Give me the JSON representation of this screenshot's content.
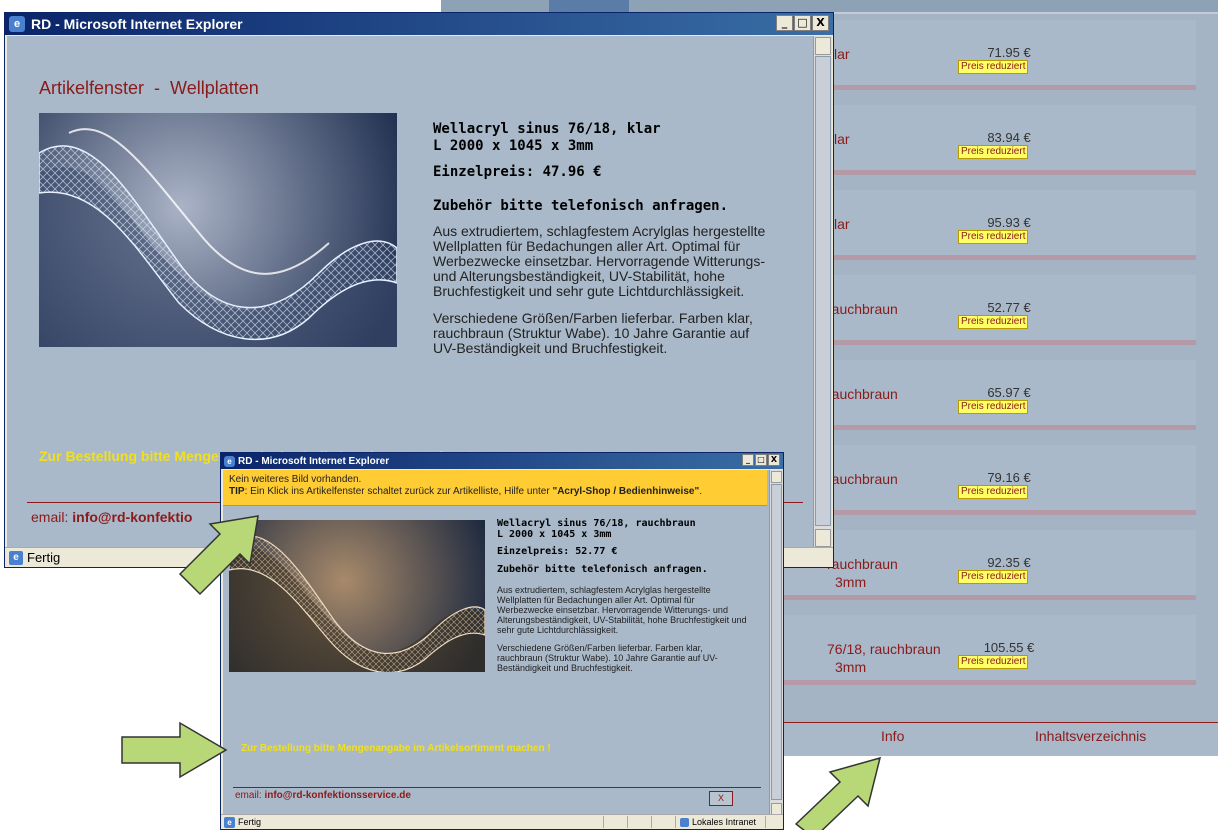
{
  "colors": {
    "page_bg": "#a4b4c4",
    "accent_red": "#8b1a1a",
    "badge_yellow": "#ffff66",
    "order_yellow": "#f0e020",
    "tip_orange": "#ffcc33",
    "arrow_green": "#b8d878",
    "titlebar_blue": "#0a246a"
  },
  "bg_page": {
    "rows": [
      {
        "name": "klar",
        "price": "71.95 €",
        "badge": "Preis reduziert"
      },
      {
        "name": "klar",
        "price": "83.94 €",
        "badge": "Preis reduziert"
      },
      {
        "name": "klar",
        "price": "95.93 €",
        "badge": "Preis reduziert"
      },
      {
        "name": "rauchbraun",
        "price": "52.77 €",
        "badge": "Preis reduziert"
      },
      {
        "name": "rauchbraun",
        "price": "65.97 €",
        "badge": "Preis reduziert"
      },
      {
        "name": "rauchbraun",
        "price": "79.16 €",
        "badge": "Preis reduziert"
      },
      {
        "name": "rauchbraun",
        "sub": "3mm",
        "price": "92.35 €",
        "badge": "Preis reduziert"
      },
      {
        "name": "76/18, rauchbraun",
        "sub": "3mm",
        "price": "105.55 €",
        "badge": "Preis reduziert"
      }
    ],
    "footer": {
      "info": "Info",
      "toc": "Inhaltsverzeichnis"
    }
  },
  "window_main": {
    "title": "RD - Microsoft Internet Explorer",
    "icon": "ie-icon",
    "buttons": {
      "minimize": "_",
      "maximize": "□",
      "close": "X"
    },
    "heading": "Artikelfenster  -  Wellplatten",
    "product_line1": "Wellacryl sinus 76/18, klar",
    "product_line2": "L 2000 x 1045 x 3mm",
    "price": "Einzelpreis: 47.96 €",
    "accessory": "Zubehör bitte telefonisch anfragen.",
    "desc1": "Aus extrudiertem, schlagfestem Acrylglas hergestellte Wellplatten für Bedachungen aller Art. Optimal für Werbezwecke einsetzbar. Hervorragende Witterungs- und Alterungsbeständigkeit, UV-Stabilität, hohe Bruchfestigkeit und sehr gute Lichtdurchlässigkeit.",
    "desc2": "Verschiedene Größen/Farben lieferbar. Farben klar, rauchbraun (Struktur Wabe). 10 Jahre Garantie auf UV-Beständigkeit und Bruchfestigkeit.",
    "order_note": "Zur Bestellung bitte Mengenangabe im Artikelsortiment machen !",
    "email_label": "email:",
    "email_value": "info@rd-konfektio",
    "status": "Fertig"
  },
  "window_popup": {
    "title": "RD - Microsoft Internet Explorer",
    "buttons": {
      "minimize": "_",
      "maximize": "□",
      "close": "X"
    },
    "tip_line1": "Kein weiteres Bild vorhanden.",
    "tip_label": "TIP",
    "tip_text": ": Ein Klick ins Artikelfenster schaltet zurück zur Artikelliste, Hilfe unter ",
    "tip_link": "\"Acryl-Shop / Bedienhinweise\"",
    "tip_end": ".",
    "product_line1": "Wellacryl sinus 76/18, rauchbraun",
    "product_line2": "L 2000 x 1045 x 3mm",
    "price": "Einzelpreis: 52.77 €",
    "accessory": "Zubehör bitte telefonisch anfragen.",
    "desc1": "Aus extrudiertem, schlagfestem Acrylglas hergestellte Wellplatten für Bedachungen aller Art. Optimal für Werbezwecke einsetzbar. Hervorragende Witterungs- und Alterungsbeständigkeit, UV-Stabilität, hohe Bruchfestigkeit und sehr gute Lichtdurchlässigkeit.",
    "desc2": "Verschiedene Größen/Farben lieferbar. Farben klar, rauchbraun (Struktur Wabe). 10 Jahre Garantie auf UV-Beständigkeit und Bruchfestigkeit.",
    "order_note": "Zur Bestellung bitte Mengenangabe im Artikelsortiment machen !",
    "email_label": "email:",
    "email_value": "info@rd-konfektionsservice.de",
    "close_label": "X",
    "status": "Fertig",
    "zone": "Lokales Intranet"
  }
}
